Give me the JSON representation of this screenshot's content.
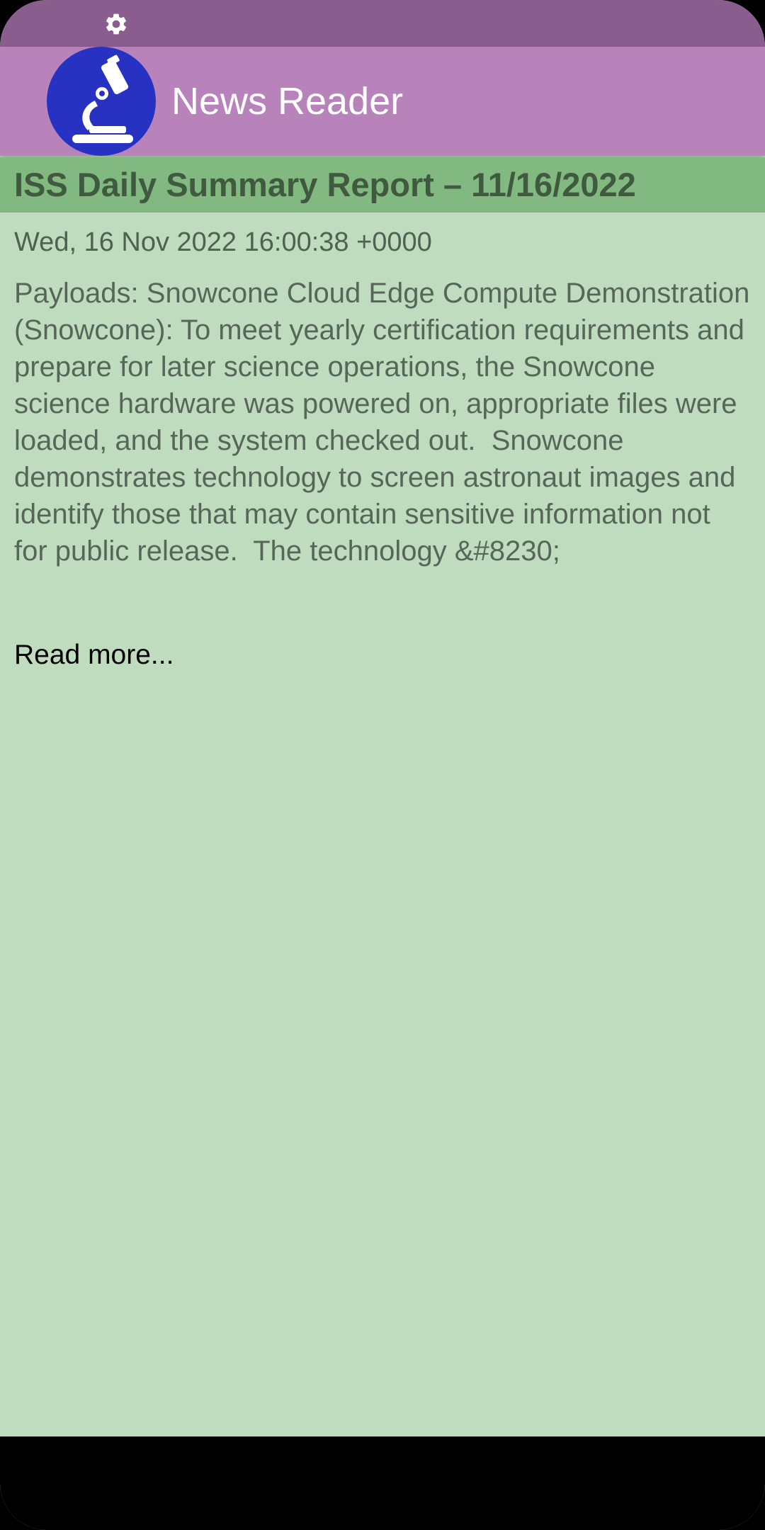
{
  "status_bar": {
    "icon": "gear-icon",
    "color": "#895e8e"
  },
  "app_bar": {
    "title": "News Reader",
    "logo_icon": "microscope-icon",
    "color": "#b882bb",
    "logo_color": "#2832c2"
  },
  "article": {
    "title": "ISS Daily Summary Report – 11/16/2022",
    "date": "Wed, 16 Nov 2022 16:00:38 +0000",
    "summary": "Payloads: Snowcone Cloud Edge Compute Demonstration (Snowcone): To meet yearly certification requirements and prepare for later science operations, the Snowcone science hardware was powered on, appropriate files were loaded, and the system checked out.  Snowcone demonstrates technology to screen astronaut images and identify those that may contain sensitive information not for public release.  The technology &#8230;",
    "read_more_label": "Read more...",
    "header_color": "#82b981",
    "background_color": "#c0dcbe"
  }
}
